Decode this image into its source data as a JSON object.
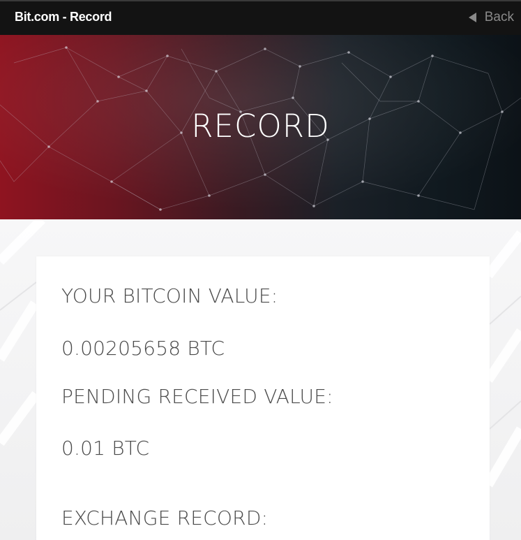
{
  "topbar": {
    "title": "Bit.com - Record",
    "back_label": "Back",
    "back_icon": "triangle-left-icon"
  },
  "hero": {
    "title": "RECORD"
  },
  "record": {
    "bitcoin_value_label": "YOUR BITCOIN VALUE:",
    "bitcoin_value": "0.00205658 BTC",
    "pending_label": "PENDING RECEIVED VALUE:",
    "pending_value": "0.01 BTC",
    "exchange_label": "EXCHANGE RECORD:"
  },
  "colors": {
    "topbar_bg": "#131313",
    "hero_red": "#8f1420",
    "hero_dark": "#0c1217",
    "text_gray": "#4a4a4a",
    "back_gray": "#8a8a8a"
  }
}
